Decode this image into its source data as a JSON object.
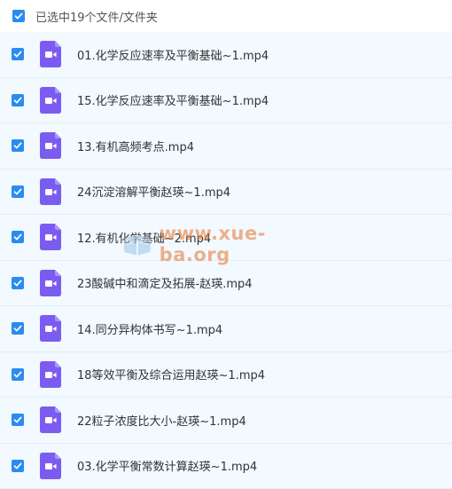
{
  "header": {
    "selection_label": "已选中19个文件/文件夹",
    "checked": true
  },
  "colors": {
    "accent": "#2a8cf0",
    "video_icon": "#7b5cf0",
    "row_bg": "#f2f9ff",
    "watermark": "#e8732b"
  },
  "files": [
    {
      "name": "01.化学反应速率及平衡基础~1.mp4",
      "icon": "video-file-icon",
      "checked": true
    },
    {
      "name": "15.化学反应速率及平衡基础~1.mp4",
      "icon": "video-file-icon",
      "checked": true
    },
    {
      "name": "13.有机高频考点.mp4",
      "icon": "video-file-icon",
      "checked": true
    },
    {
      "name": "24沉淀溶解平衡赵瑛~1.mp4",
      "icon": "video-file-icon",
      "checked": true
    },
    {
      "name": "12.有机化学基础~2.mp4",
      "icon": "video-file-icon",
      "checked": true
    },
    {
      "name": "23酸碱中和滴定及拓展-赵瑛.mp4",
      "icon": "video-file-icon",
      "checked": true
    },
    {
      "name": "14.同分异构体书写~1.mp4",
      "icon": "video-file-icon",
      "checked": true
    },
    {
      "name": "18等效平衡及综合运用赵瑛~1.mp4",
      "icon": "video-file-icon",
      "checked": true
    },
    {
      "name": "22粒子浓度比大小-赵瑛~1.mp4",
      "icon": "video-file-icon",
      "checked": true
    },
    {
      "name": "03.化学平衡常数计算赵瑛~1.mp4",
      "icon": "video-file-icon",
      "checked": true
    }
  ],
  "watermark": {
    "text": "www.xue-ba.org"
  }
}
